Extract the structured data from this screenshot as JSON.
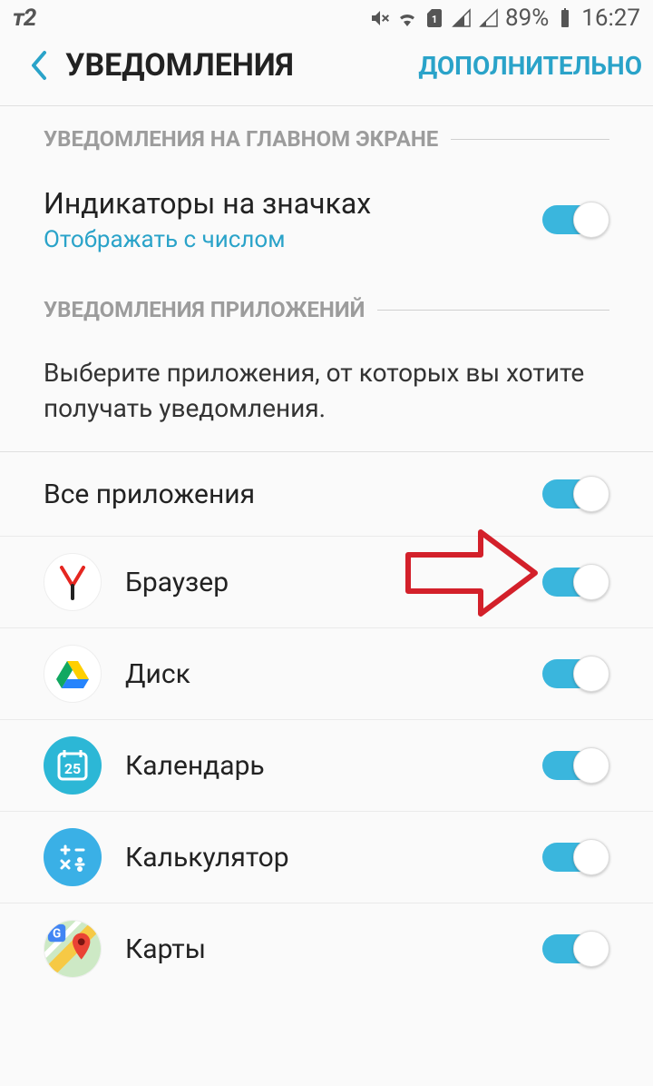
{
  "statusBar": {
    "carrier": "т2",
    "battery": "89%",
    "time": "16:27",
    "simLabel": "1"
  },
  "header": {
    "title": "УВЕДОМЛЕНИЯ",
    "advanced": "ДОПОЛНИТЕЛЬНО"
  },
  "section1": {
    "title": "УВЕДОМЛЕНИЯ НА ГЛАВНОМ ЭКРАНЕ"
  },
  "badgeSetting": {
    "title": "Индикаторы на значках",
    "subtitle": "Отображать с числом",
    "enabled": true
  },
  "section2": {
    "title": "УВЕДОМЛЕНИЯ ПРИЛОЖЕНИЙ"
  },
  "description": "Выберите приложения, от которых вы хотите получать уведомления.",
  "allApps": {
    "label": "Все приложения",
    "enabled": true
  },
  "apps": [
    {
      "id": "browser",
      "label": "Браузер",
      "enabled": true
    },
    {
      "id": "disk",
      "label": "Диск",
      "enabled": true
    },
    {
      "id": "calendar",
      "label": "Календарь",
      "calendarDay": "25",
      "enabled": true
    },
    {
      "id": "calculator",
      "label": "Калькулятор",
      "enabled": true
    },
    {
      "id": "maps",
      "label": "Карты",
      "enabled": true
    }
  ]
}
